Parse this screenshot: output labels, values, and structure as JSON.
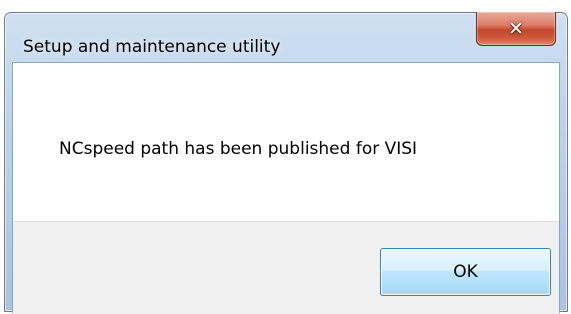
{
  "window": {
    "title": "Setup and maintenance utility"
  },
  "title_bar": {
    "close_icon": "close-icon",
    "close_glyph": "✕"
  },
  "message": {
    "text": "NCspeed path has been published for VISI"
  },
  "buttons": {
    "ok_label": "OK"
  },
  "colors": {
    "close_button": "#c4462b",
    "ok_button_border": "#3c7fb1",
    "frame": "#b3cbe5"
  }
}
